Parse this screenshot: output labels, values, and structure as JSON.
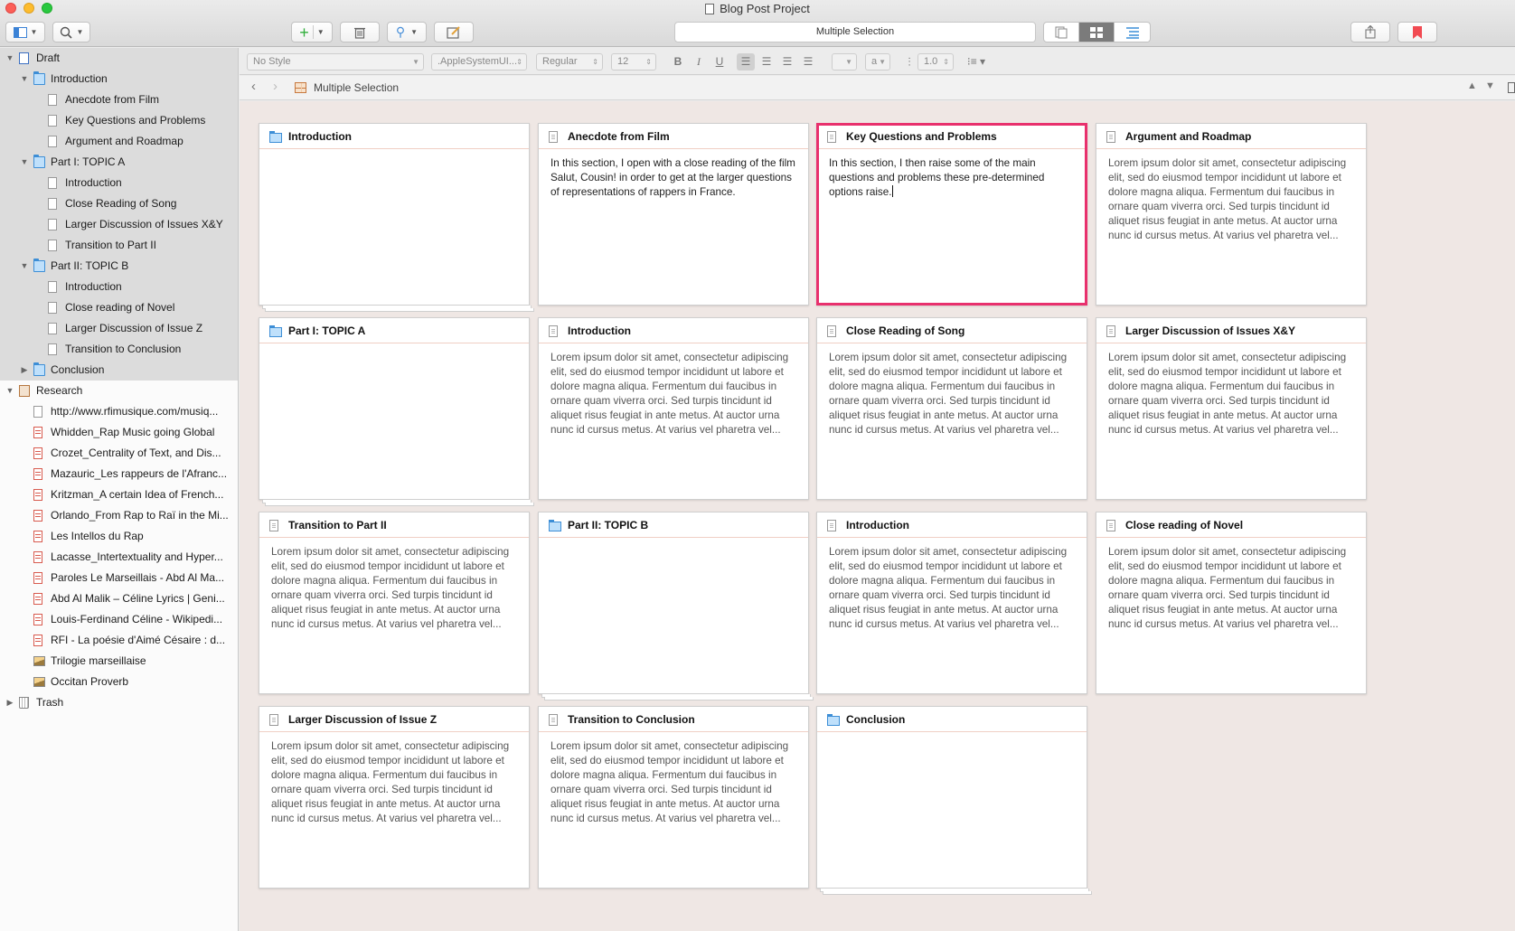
{
  "window": {
    "title": "Blog Post Project"
  },
  "toolbar": {
    "selection_label": "Multiple Selection"
  },
  "format": {
    "style": "No Style",
    "font": ".AppleSystemUI...",
    "weight": "Regular",
    "size": "12",
    "bold": "B",
    "italic": "I",
    "underline": "U",
    "line_spacing": "1.0",
    "highlight": "a"
  },
  "header": {
    "title": "Multiple Selection"
  },
  "binder": [
    {
      "label": "Draft",
      "level": 0,
      "icon": "draft",
      "arrow": "▼",
      "selected": true
    },
    {
      "label": "Introduction",
      "level": 1,
      "icon": "folder",
      "arrow": "▼",
      "selected": true
    },
    {
      "label": "Anecdote from Film",
      "level": 2,
      "icon": "doc",
      "selected": true
    },
    {
      "label": "Key Questions and Problems",
      "level": 2,
      "icon": "doc",
      "selected": true
    },
    {
      "label": "Argument and Roadmap",
      "level": 2,
      "icon": "doc",
      "selected": true
    },
    {
      "label": "Part I: TOPIC A",
      "level": 1,
      "icon": "folder",
      "arrow": "▼",
      "selected": true
    },
    {
      "label": "Introduction",
      "level": 2,
      "icon": "doc",
      "selected": true
    },
    {
      "label": "Close Reading of Song",
      "level": 2,
      "icon": "doc",
      "selected": true
    },
    {
      "label": "Larger Discussion of Issues X&Y",
      "level": 2,
      "icon": "doc",
      "selected": true
    },
    {
      "label": "Transition to Part II",
      "level": 2,
      "icon": "doc",
      "selected": true
    },
    {
      "label": "Part II: TOPIC B",
      "level": 1,
      "icon": "folder",
      "arrow": "▼",
      "selected": true
    },
    {
      "label": "Introduction",
      "level": 2,
      "icon": "doc",
      "selected": true
    },
    {
      "label": "Close reading of Novel",
      "level": 2,
      "icon": "doc",
      "selected": true
    },
    {
      "label": "Larger Discussion of Issue Z",
      "level": 2,
      "icon": "doc",
      "selected": true
    },
    {
      "label": "Transition to Conclusion",
      "level": 2,
      "icon": "doc",
      "selected": true
    },
    {
      "label": "Conclusion",
      "level": 1,
      "icon": "folder",
      "arrow": "▶",
      "selected": true
    },
    {
      "label": "Research",
      "level": 0,
      "icon": "research",
      "arrow": "▼"
    },
    {
      "label": "http://www.rfimusique.com/musiq...",
      "level": 1,
      "icon": "web"
    },
    {
      "label": "Whidden_Rap Music going Global",
      "level": 1,
      "icon": "pdf"
    },
    {
      "label": "Crozet_Centrality of Text, and Dis...",
      "level": 1,
      "icon": "pdf"
    },
    {
      "label": "Mazauric_Les rappeurs de l'Afranc...",
      "level": 1,
      "icon": "pdf"
    },
    {
      "label": "Kritzman_A certain Idea of French...",
      "level": 1,
      "icon": "pdf"
    },
    {
      "label": "Orlando_From Rap to Raï in the Mi...",
      "level": 1,
      "icon": "pdf"
    },
    {
      "label": "Les Intellos du Rap",
      "level": 1,
      "icon": "pdf"
    },
    {
      "label": "Lacasse_Intertextuality and Hyper...",
      "level": 1,
      "icon": "pdf"
    },
    {
      "label": "Paroles Le Marseillais - Abd Al Ma...",
      "level": 1,
      "icon": "pdf"
    },
    {
      "label": "Abd Al Malik – Céline Lyrics | Geni...",
      "level": 1,
      "icon": "pdf"
    },
    {
      "label": "Louis-Ferdinand Céline - Wikipedi...",
      "level": 1,
      "icon": "pdf"
    },
    {
      "label": "RFI - La poésie d'Aimé Césaire : d...",
      "level": 1,
      "icon": "pdf"
    },
    {
      "label": "Trilogie marseillaise",
      "level": 1,
      "icon": "img"
    },
    {
      "label": "Occitan Proverb",
      "level": 1,
      "icon": "img"
    },
    {
      "label": "Trash",
      "level": 0,
      "icon": "trash",
      "arrow": "▶"
    }
  ],
  "lorem": "Lorem ipsum dolor sit amet, consectetur adipiscing elit, sed do eiusmod tempor incididunt ut labore et dolore magna aliqua. Fermentum dui faucibus in ornare quam viverra orci. Sed turpis tincidunt id aliquet risus feugiat in ante metus. At auctor urna nunc id cursus metus. At varius vel pharetra vel...",
  "cards": [
    {
      "title": "Introduction",
      "type": "folder",
      "body": ""
    },
    {
      "title": "Anecdote from Film",
      "type": "doc",
      "body": "In this section, I open with a close reading of the film Salut, Cousin! in order to get at the larger questions of representations of rappers in France."
    },
    {
      "title": "Key Questions and Problems",
      "type": "doc",
      "body": "In this section, I then raise some of the main questions and problems these pre-determined options raise.",
      "selected": true
    },
    {
      "title": "Argument and Roadmap",
      "type": "doc",
      "body": "Lorem ipsum dolor sit amet, consectetur adipiscing elit, sed do eiusmod tempor incididunt ut labore et dolore magna aliqua. Fermentum dui faucibus in ornare quam viverra orci. Sed turpis tincidunt id aliquet risus feugiat in ante metus. At auctor urna nunc id cursus metus. At varius vel pharetra vel..."
    },
    {
      "title": "Part I: TOPIC A",
      "type": "folder",
      "body": ""
    },
    {
      "title": "Introduction",
      "type": "doc",
      "body": "Lorem ipsum dolor sit amet, consectetur adipiscing elit, sed do eiusmod tempor incididunt ut labore et dolore magna aliqua. Fermentum dui faucibus in ornare quam viverra orci. Sed turpis tincidunt id aliquet risus feugiat in ante metus. At auctor urna nunc id cursus metus. At varius vel pharetra vel..."
    },
    {
      "title": "Close Reading of Song",
      "type": "doc",
      "body": "Lorem ipsum dolor sit amet, consectetur adipiscing elit, sed do eiusmod tempor incididunt ut labore et dolore magna aliqua. Fermentum dui faucibus in ornare quam viverra orci. Sed turpis tincidunt id aliquet risus feugiat in ante metus. At auctor urna nunc id cursus metus. At varius vel pharetra vel..."
    },
    {
      "title": "Larger Discussion of Issues X&Y",
      "type": "doc",
      "body": "Lorem ipsum dolor sit amet, consectetur adipiscing elit, sed do eiusmod tempor incididunt ut labore et dolore magna aliqua. Fermentum dui faucibus in ornare quam viverra orci. Sed turpis tincidunt id aliquet risus feugiat in ante metus. At auctor urna nunc id cursus metus. At varius vel pharetra vel..."
    },
    {
      "title": "Transition to Part II",
      "type": "doc",
      "body": "Lorem ipsum dolor sit amet, consectetur adipiscing elit, sed do eiusmod tempor incididunt ut labore et dolore magna aliqua. Fermentum dui faucibus in ornare quam viverra orci. Sed turpis tincidunt id aliquet risus feugiat in ante metus. At auctor urna nunc id cursus metus. At varius vel pharetra vel..."
    },
    {
      "title": "Part II: TOPIC B",
      "type": "folder",
      "body": ""
    },
    {
      "title": "Introduction",
      "type": "doc",
      "body": "Lorem ipsum dolor sit amet, consectetur adipiscing elit, sed do eiusmod tempor incididunt ut labore et dolore magna aliqua. Fermentum dui faucibus in ornare quam viverra orci. Sed turpis tincidunt id aliquet risus feugiat in ante metus. At auctor urna nunc id cursus metus. At varius vel pharetra vel..."
    },
    {
      "title": "Close reading of Novel",
      "type": "doc",
      "body": "Lorem ipsum dolor sit amet, consectetur adipiscing elit, sed do eiusmod tempor incididunt ut labore et dolore magna aliqua. Fermentum dui faucibus in ornare quam viverra orci. Sed turpis tincidunt id aliquet risus feugiat in ante metus. At auctor urna nunc id cursus metus. At varius vel pharetra vel..."
    },
    {
      "title": "Larger Discussion of Issue Z",
      "type": "doc",
      "body": "Lorem ipsum dolor sit amet, consectetur adipiscing elit, sed do eiusmod tempor incididunt ut labore et dolore magna aliqua. Fermentum dui faucibus in ornare quam viverra orci. Sed turpis tincidunt id aliquet risus feugiat in ante metus. At auctor urna nunc id cursus metus. At varius vel pharetra vel..."
    },
    {
      "title": "Transition to Conclusion",
      "type": "doc",
      "body": "Lorem ipsum dolor sit amet, consectetur adipiscing elit, sed do eiusmod tempor incididunt ut labore et dolore magna aliqua. Fermentum dui faucibus in ornare quam viverra orci. Sed turpis tincidunt id aliquet risus feugiat in ante metus. At auctor urna nunc id cursus metus. At varius vel pharetra vel..."
    },
    {
      "title": "Conclusion",
      "type": "folder",
      "body": ""
    }
  ],
  "colors": {
    "selection_border": "#e8306d",
    "folder_blue": "#3d8ed6",
    "corkboard_bg": "#efe7e4"
  }
}
